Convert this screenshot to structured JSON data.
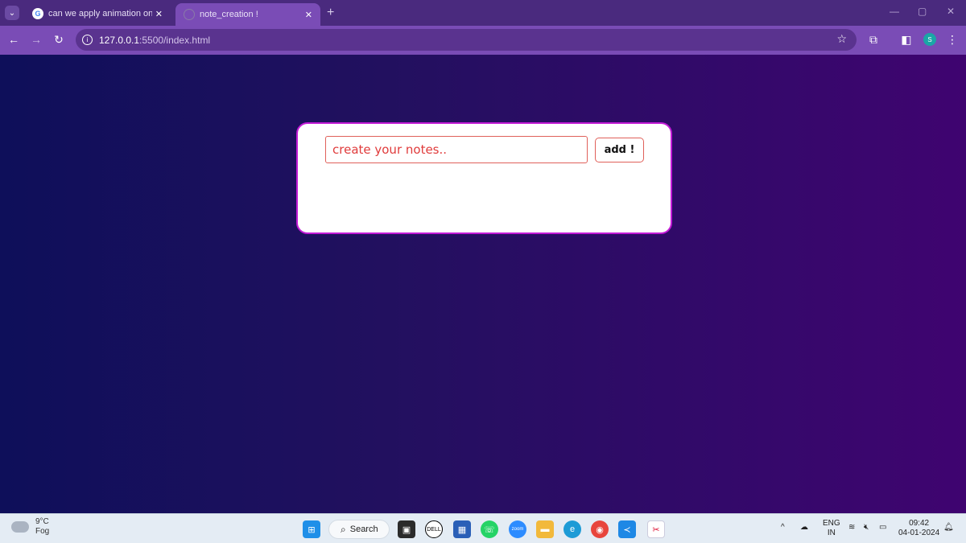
{
  "browser": {
    "tabs": [
      {
        "title": "can we apply animation on scro",
        "active": false,
        "favicon": "google-g-icon"
      },
      {
        "title": "note_creation !",
        "active": true,
        "favicon": "globe-icon"
      }
    ],
    "url_host": "127.0.0.1",
    "url_rest": ":5500/index.html"
  },
  "page": {
    "input_placeholder": "create your notes..",
    "add_label": "add !",
    "background_gradient": [
      "#0e0f5a",
      "#3f0470"
    ],
    "card_border_color": "#c21ad6",
    "accent_red": "#e03b3b"
  },
  "taskbar": {
    "weather_temp": "9°C",
    "weather_desc": "Fog",
    "search_label": "Search",
    "lang_primary": "ENG",
    "lang_secondary": "IN",
    "time": "09:42",
    "date": "04-01-2024"
  }
}
